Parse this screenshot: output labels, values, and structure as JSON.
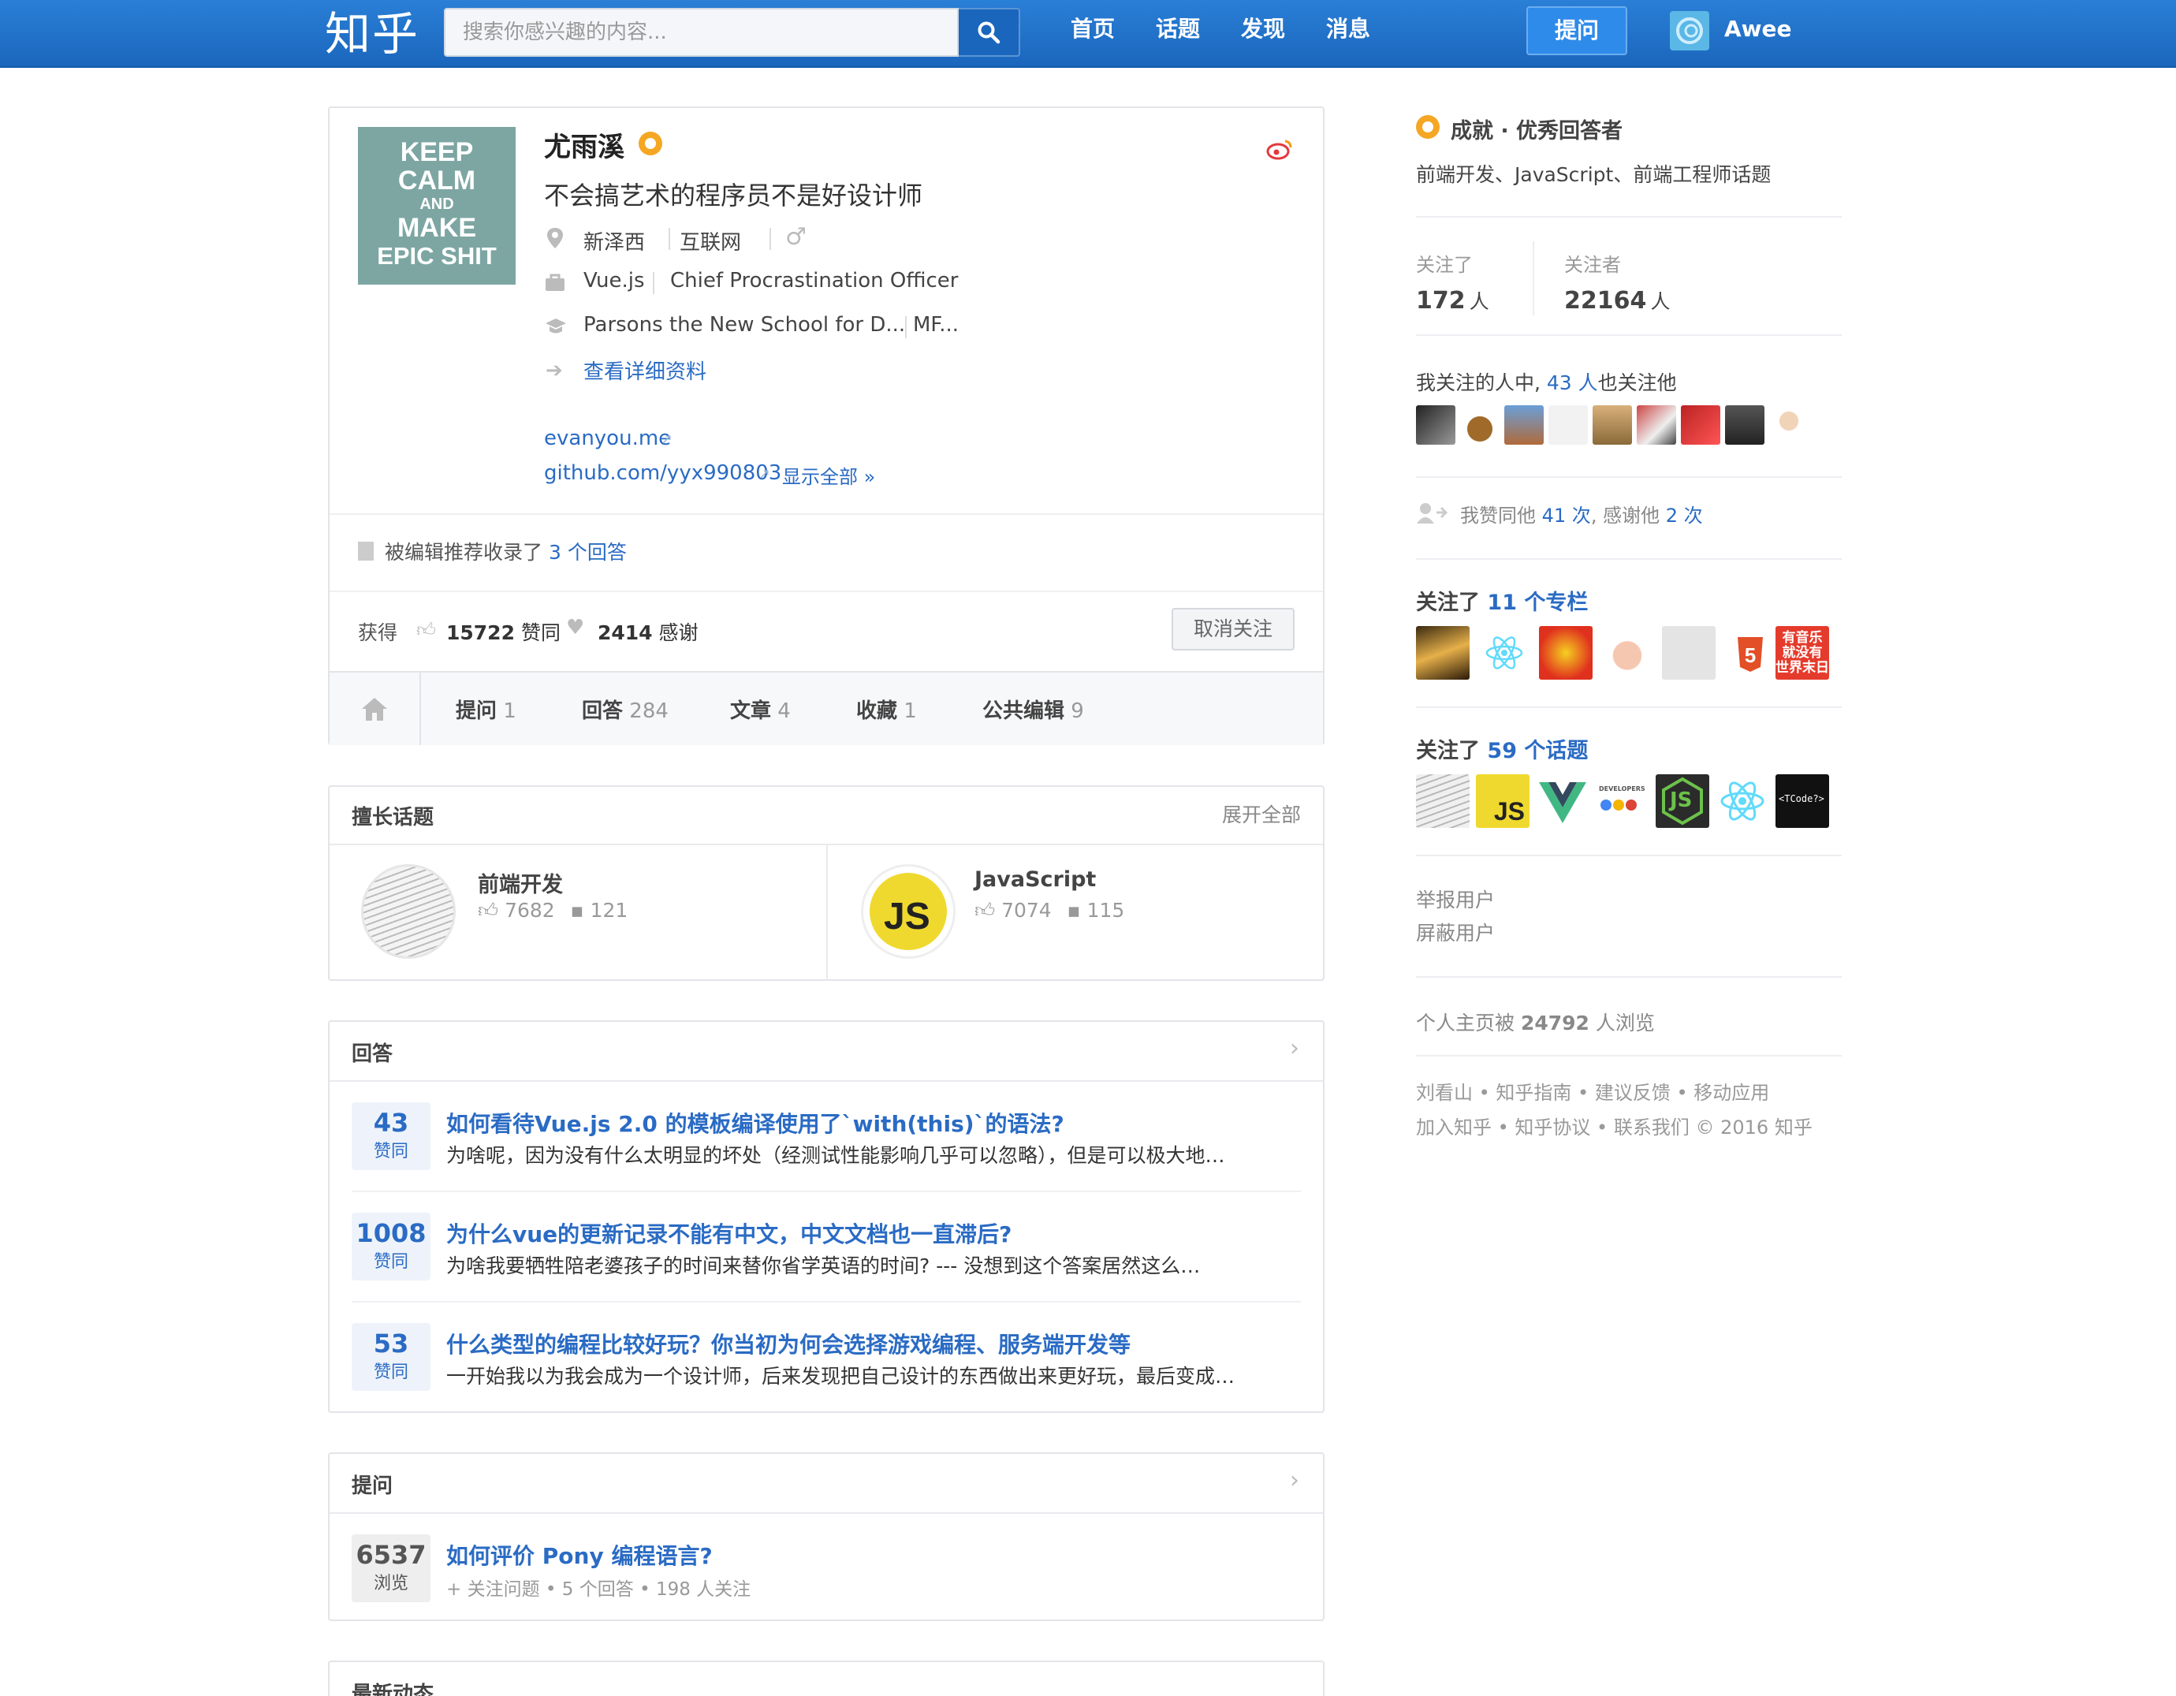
{
  "header": {
    "logo": "知乎",
    "search_placeholder": "搜索你感兴趣的内容...",
    "nav": [
      "首页",
      "话题",
      "发现",
      "消息"
    ],
    "ask_label": "提问",
    "user_name": "Awee"
  },
  "profile": {
    "avatar_lines": [
      "KEEP",
      "CALM",
      "AND",
      "MAKE",
      "EPIC SHIT"
    ],
    "name": "尤雨溪",
    "headline": "不会搞艺术的程序员不是好设计师",
    "location": "新泽西",
    "industry": "互联网",
    "gender_icon": "♂",
    "company": "Vue.js",
    "position": "Chief Procrastination Officer",
    "school": "Parsons the New School for D...",
    "major": "MF...",
    "details_link": "查看详细资料",
    "links": [
      "evanyou.me",
      "github.com/yyx990803"
    ],
    "show_all": "显示全部 »",
    "editor_pick_prefix": "被编辑推荐收录了",
    "editor_pick_link": "3 个回答",
    "stats_prefix": "获得",
    "votes": "15722",
    "votes_label": "赞同",
    "thanks": "2414",
    "thanks_label": "感谢",
    "unfollow_label": "取消关注",
    "tabs": [
      {
        "label": "提问",
        "count": "1"
      },
      {
        "label": "回答",
        "count": "284"
      },
      {
        "label": "文章",
        "count": "4"
      },
      {
        "label": "收藏",
        "count": "1"
      },
      {
        "label": "公共编辑",
        "count": "9"
      }
    ]
  },
  "skills": {
    "title": "擅长话题",
    "expand": "展开全部",
    "topics": [
      {
        "name": "前端开发",
        "votes": "7682",
        "comments": "121"
      },
      {
        "name": "JavaScript",
        "votes": "7074",
        "comments": "115",
        "logo": "JS"
      }
    ]
  },
  "answers": {
    "title": "回答",
    "unit": "赞同",
    "items": [
      {
        "votes": "43",
        "title": "如何看待Vue.js 2.0 的模板编译使用了`with(this)`的语法?",
        "excerpt": "为啥呢，因为没有什么太明显的坏处（经测试性能影响几乎可以忽略），但是可以极大地…"
      },
      {
        "votes": "1008",
        "title": "为什么vue的更新记录不能有中文，中文文档也一直滞后?",
        "excerpt": "为啥我要牺牲陪老婆孩子的时间来替你省学英语的时间? --- 没想到这个答案居然这么…"
      },
      {
        "votes": "53",
        "title": "什么类型的编程比较好玩？你当初为何会选择游戏编程、服务端开发等",
        "excerpt": "一开始我以为我会成为一个设计师，后来发现把自己设计的东西做出来更好玩，最后变成…"
      }
    ]
  },
  "questions": {
    "title": "提问",
    "items": [
      {
        "views": "6537",
        "views_label": "浏览",
        "title": "如何评价 Pony 编程语言?",
        "follow": "+ 关注问题",
        "answers": "5 个回答",
        "followers": "198 人关注"
      }
    ]
  },
  "recent": {
    "title": "最新动态"
  },
  "sidebar": {
    "achievement_title": "成就 · 优秀回答者",
    "achievement_topics": "前端开发、JavaScript、前端工程师话题",
    "following_label": "关注了",
    "following_count": "172",
    "followers_label": "关注者",
    "followers_count": "22164",
    "person_unit": "人",
    "mutual_prefix": "我关注的人中,",
    "mutual_link": "43 人",
    "mutual_suffix": "也关注他",
    "agree_prefix": "我赞同他",
    "agree_link": "41 次",
    "thank_prefix": ", 感谢他",
    "thank_link": "2 次",
    "columns_prefix": "关注了",
    "columns_link": "11 个专栏",
    "column_badge": "有音乐\n就没有\n世界末日",
    "topics_prefix": "关注了",
    "topics_link": "59 个话题",
    "topic_badges": [
      "JS",
      "V",
      "DEVELOPERS",
      "JS",
      "<TCode?>"
    ],
    "report": "举报用户",
    "block": "屏蔽用户",
    "views_prefix": "个人主页被",
    "views_count": "24792",
    "views_suffix": "人浏览",
    "footer1": [
      "刘看山",
      "知乎指南",
      "建议反馈",
      "移动应用"
    ],
    "footer2": [
      "加入知乎",
      "知乎协议",
      "联系我们"
    ],
    "copyright": "© 2016 知乎"
  },
  "colors": {
    "brand": "#1f6fc4",
    "link": "#2a6bc4",
    "badge": "#f5a623"
  }
}
